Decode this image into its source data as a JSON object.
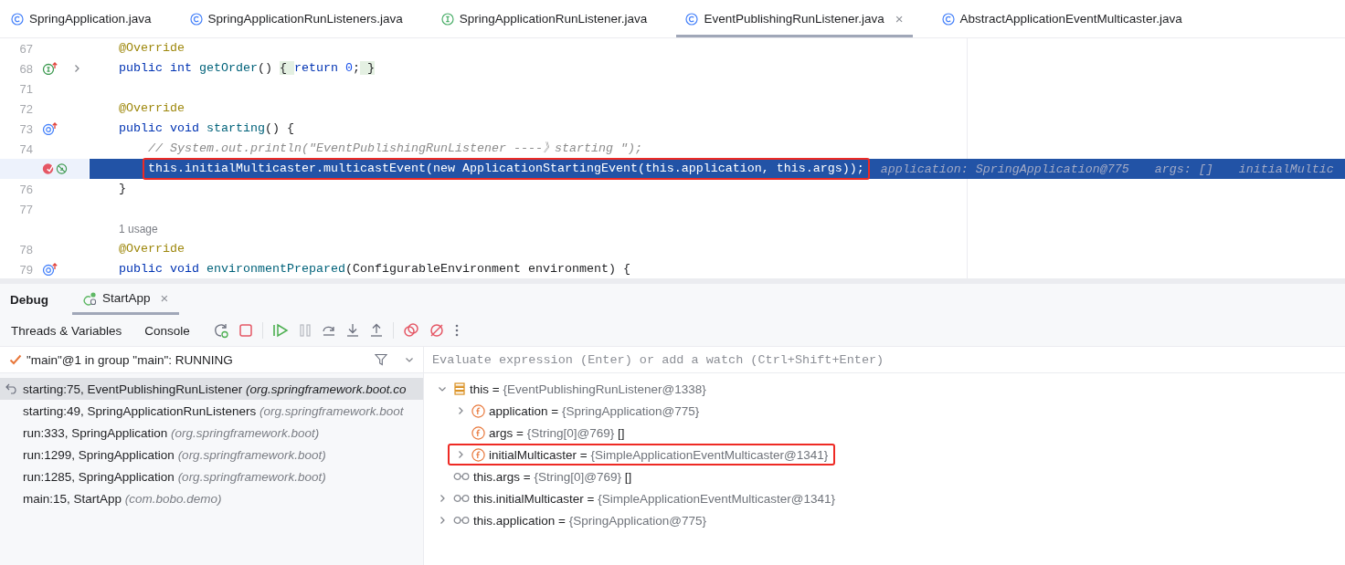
{
  "editor_tabs": [
    {
      "label": "SpringApplication.java",
      "kind": "class",
      "selected": false
    },
    {
      "label": "SpringApplicationRunListeners.java",
      "kind": "class",
      "selected": false
    },
    {
      "label": "SpringApplicationRunListener.java",
      "kind": "interface",
      "selected": false
    },
    {
      "label": "EventPublishingRunListener.java",
      "kind": "class",
      "selected": true,
      "close": "×"
    },
    {
      "label": "AbstractApplicationEventMulticaster.java",
      "kind": "class",
      "selected": false
    }
  ],
  "code_lines": [
    {
      "kind": "code",
      "number": "67",
      "fold": false,
      "current": false,
      "outlined": false,
      "tokens": [
        {
          "kind": "ann",
          "text": "@Override"
        }
      ]
    },
    {
      "kind": "code",
      "number": "68",
      "gutter_icons": [
        {
          "kind": "implements"
        }
      ],
      "fold": true,
      "current": false,
      "outlined": false,
      "tokens": [
        {
          "kind": "kw",
          "text": "public int"
        },
        {
          "kind": "fn",
          "text": " getOrder"
        },
        {
          "kind": "plain",
          "text": "() "
        },
        {
          "kind": "fold",
          "text": "{ "
        },
        {
          "kind": "kw",
          "text": "return"
        },
        {
          "kind": "num",
          "text": " 0"
        },
        {
          "kind": "plain",
          "text": ";"
        },
        {
          "kind": "fold",
          "text": " }"
        }
      ]
    },
    {
      "kind": "code",
      "number": "71",
      "fold": false,
      "current": false,
      "outlined": false
    },
    {
      "kind": "code",
      "number": "72",
      "fold": false,
      "current": false,
      "outlined": false,
      "tokens": [
        {
          "kind": "ann",
          "text": "@Override"
        }
      ]
    },
    {
      "kind": "code",
      "number": "73",
      "gutter_icons": [
        {
          "kind": "override"
        }
      ],
      "fold": false,
      "current": false,
      "outlined": false,
      "tokens": [
        {
          "kind": "kw",
          "text": "public void"
        },
        {
          "kind": "fn",
          "text": " starting"
        },
        {
          "kind": "plain",
          "text": "() {"
        }
      ],
      "children": [
        {
          "kind": "code",
          "number": "74",
          "fold": false,
          "current": false,
          "outlined": false,
          "tokens": [
            {
              "kind": "comment",
              "text": "// System.out.println(\"EventPublishingRunListener ----》starting \");"
            }
          ]
        },
        {
          "kind": "code",
          "gutter_icons": [
            {
              "kind": "breakpoint"
            },
            {
              "kind": "execution"
            }
          ],
          "fold": false,
          "current": true,
          "outlined": true,
          "tokens": [
            {
              "kind": "plain",
              "text": "this.initialMulticaster.multicastEvent(new ApplicationStartingEvent(this.application, this.args));"
            }
          ],
          "hints": [
            "application: SpringApplication@775",
            "args: []",
            "initialMultic"
          ]
        }
      ]
    },
    {
      "kind": "code",
      "number": "76",
      "fold": false,
      "current": false,
      "outlined": false,
      "tokens": [
        {
          "kind": "plain",
          "text": "}"
        }
      ]
    },
    {
      "kind": "code",
      "number": "77",
      "fold": false,
      "current": false,
      "outlined": false
    },
    {
      "kind": "lens",
      "text": "1 usage"
    },
    {
      "kind": "code",
      "number": "78",
      "fold": false,
      "current": false,
      "outlined": false,
      "tokens": [
        {
          "kind": "ann",
          "text": "@Override"
        }
      ]
    },
    {
      "kind": "code",
      "number": "79",
      "gutter_icons": [
        {
          "kind": "override"
        }
      ],
      "fold": false,
      "current": false,
      "outlined": false,
      "tokens": [
        {
          "kind": "kw",
          "text": "public void"
        },
        {
          "kind": "fn",
          "text": " environmentPrepared"
        },
        {
          "kind": "plain",
          "text": "(ConfigurableEnvironment environment) {"
        }
      ]
    }
  ],
  "debug": {
    "title": "Debug",
    "session_tabs": [
      {
        "label": "StartApp",
        "selected": true,
        "close": "×"
      }
    ],
    "view_tabs": [
      "Threads & Variables",
      "Console"
    ],
    "thread": "\"main\"@1 in group \"main\": RUNNING",
    "frames": [
      {
        "location": "starting:75, EventPublishingRunListener",
        "package": "(org.springframework.boot.co",
        "selected": true
      },
      {
        "location": "starting:49, SpringApplicationRunListeners",
        "package": "(org.springframework.boot",
        "selected": false
      },
      {
        "location": "run:333, SpringApplication",
        "package": "(org.springframework.boot)",
        "selected": false
      },
      {
        "location": "run:1299, SpringApplication",
        "package": "(org.springframework.boot)",
        "selected": false
      },
      {
        "location": "run:1285, SpringApplication",
        "package": "(org.springframework.boot)",
        "selected": false
      },
      {
        "location": "main:15, StartApp",
        "package": "(com.bobo.demo)",
        "selected": false
      }
    ],
    "evaluate_placeholder": "Evaluate expression (Enter) or add a watch (Ctrl+Shift+Enter)",
    "variables": [
      {
        "kind": "object",
        "name": "this",
        "separator": "=",
        "value": "{EventPublishingRunListener@1338}",
        "expandable": true,
        "expanded": true,
        "outlined": false,
        "children": [
          {
            "kind": "field",
            "name": "application",
            "separator": "=",
            "value": "{SpringApplication@775}",
            "expandable": true,
            "expanded": false,
            "outlined": false
          },
          {
            "kind": "field",
            "name": "args",
            "separator": "=",
            "value": "{String[0]@769}",
            "extra": "[]",
            "expandable": false,
            "outlined": false
          },
          {
            "kind": "field",
            "name": "initialMulticaster",
            "separator": "=",
            "value": "{SimpleApplicationEventMulticaster@1341}",
            "expandable": true,
            "expanded": false,
            "outlined": true
          }
        ]
      },
      {
        "kind": "watch",
        "name": "this.args",
        "separator": "=",
        "value": "{String[0]@769}",
        "extra": "[]",
        "expandable": false,
        "outlined": false
      },
      {
        "kind": "watch",
        "name": "this.initialMulticaster",
        "separator": "=",
        "value": "{SimpleApplicationEventMulticaster@1341}",
        "expandable": true,
        "expanded": false,
        "outlined": false
      },
      {
        "kind": "watch",
        "name": "this.application",
        "separator": "=",
        "value": "{SpringApplication@775}",
        "expandable": true,
        "expanded": false,
        "outlined": false
      }
    ]
  }
}
